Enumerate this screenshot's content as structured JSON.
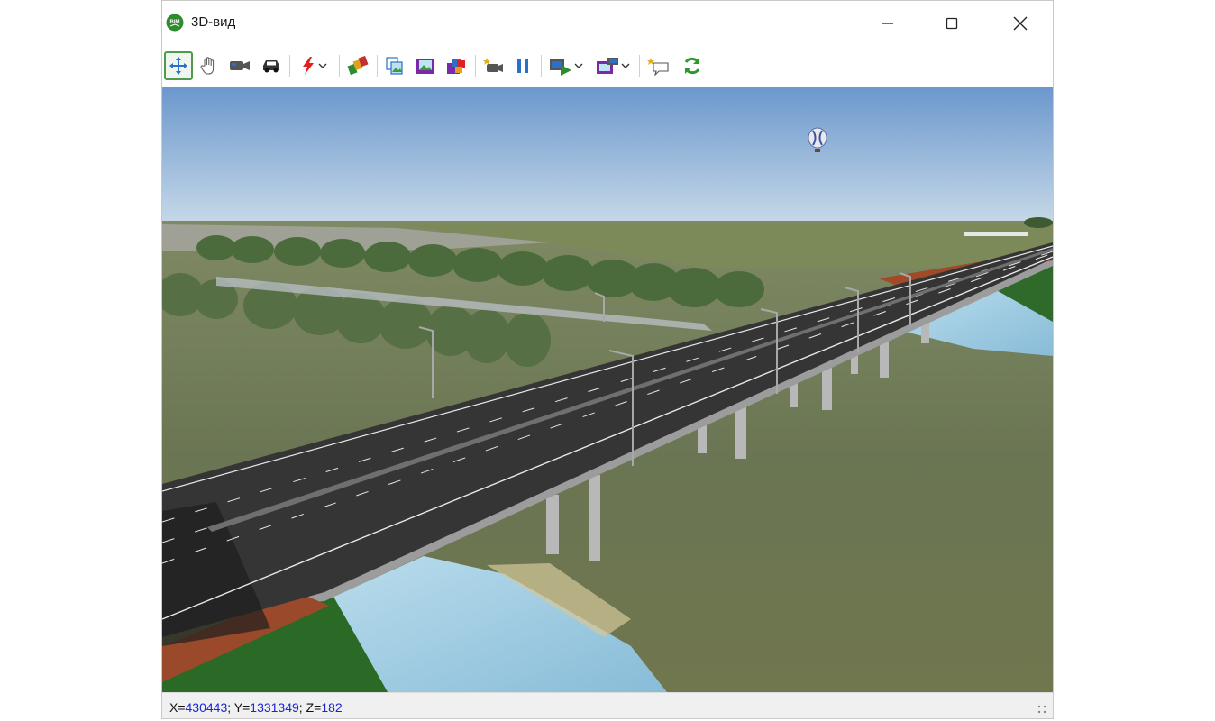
{
  "window": {
    "title": "3D-вид",
    "app_icon_text": "BIM"
  },
  "toolbar": {
    "buttons": [
      {
        "name": "pan-move-tool",
        "icon": "move-arrows-icon",
        "active": true
      },
      {
        "name": "hand-tool",
        "icon": "hand-icon"
      },
      {
        "name": "camera-tool",
        "icon": "video-camera-icon"
      },
      {
        "name": "drive-mode",
        "icon": "car-icon"
      },
      {
        "name": "lightning-dropdown",
        "icon": "lightning-icon"
      },
      {
        "name": "materials-tool",
        "icon": "palette-icon"
      },
      {
        "name": "copy-view",
        "icon": "copy-image-icon"
      },
      {
        "name": "save-image",
        "icon": "image-icon"
      },
      {
        "name": "layers-view",
        "icon": "layers-icon"
      },
      {
        "name": "record-video",
        "icon": "record-camera-icon"
      },
      {
        "name": "pause",
        "icon": "pause-icon"
      },
      {
        "name": "play-animation",
        "icon": "play-film-icon"
      },
      {
        "name": "animation-settings",
        "icon": "film-settings-icon"
      },
      {
        "name": "comment",
        "icon": "comment-icon"
      },
      {
        "name": "refresh",
        "icon": "refresh-icon"
      }
    ]
  },
  "status": {
    "x_label": "X=",
    "x_value": "430443",
    "y_label": "; Y=",
    "y_value": "1331349",
    "z_label": "; Z=",
    "z_value": "182"
  },
  "colors": {
    "accent": "#2e8b2e",
    "coord_value": "#1a25d8",
    "sky_top": "#6d9bd0",
    "sky_bottom": "#c2d6e6",
    "road": "#333333",
    "water": "#9ccbe0"
  }
}
